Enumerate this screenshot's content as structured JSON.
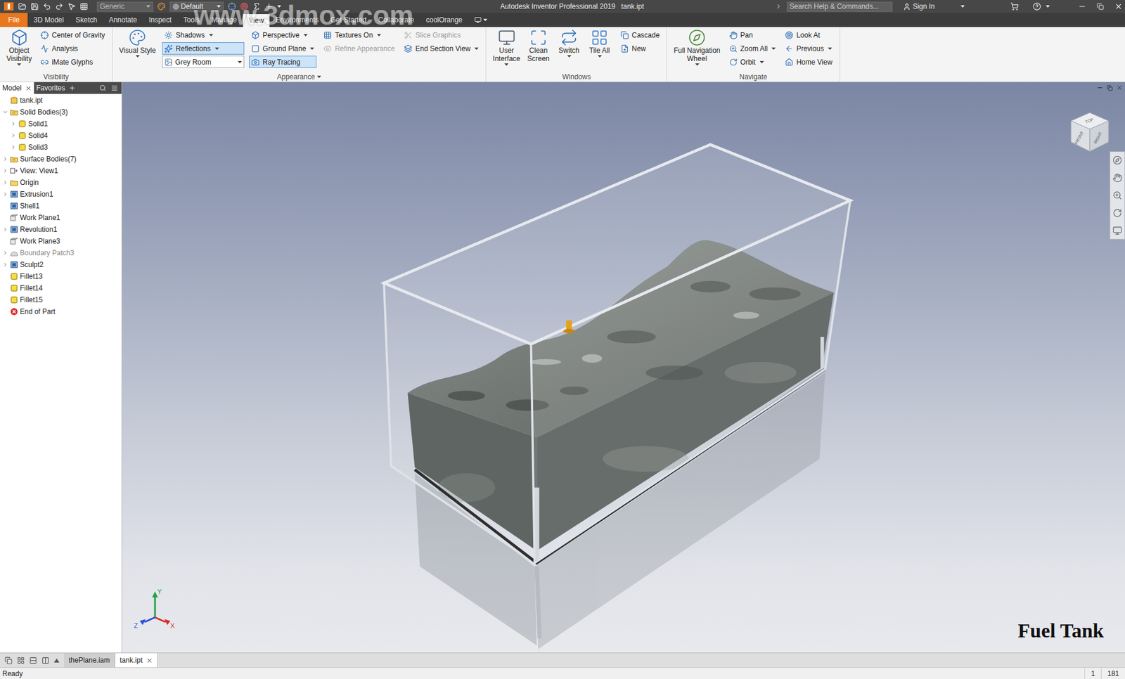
{
  "window": {
    "title": "Autodesk Inventor Professional 2019",
    "document": "tank.ipt"
  },
  "quick_access": {
    "material": "Generic",
    "appearance": "Default"
  },
  "search": {
    "placeholder": "Search Help & Commands..."
  },
  "account": {
    "label": "Sign In"
  },
  "ribbon_tabs": [
    {
      "label": "File",
      "selected": false,
      "kind": "file"
    },
    {
      "label": "3D Model",
      "selected": false,
      "kind": "tab"
    },
    {
      "label": "Sketch",
      "selected": false,
      "kind": "tab"
    },
    {
      "label": "Annotate",
      "selected": false,
      "kind": "tab"
    },
    {
      "label": "Inspect",
      "selected": false,
      "kind": "tab"
    },
    {
      "label": "Tools",
      "selected": false,
      "kind": "tab"
    },
    {
      "label": "Manage",
      "selected": false,
      "kind": "tab"
    },
    {
      "label": "View",
      "selected": true,
      "kind": "tab"
    },
    {
      "label": "Environments",
      "selected": false,
      "kind": "tab"
    },
    {
      "label": "Get Started",
      "selected": false,
      "kind": "tab"
    },
    {
      "label": "Collaborate",
      "selected": false,
      "kind": "tab"
    },
    {
      "label": "coolOrange",
      "selected": false,
      "kind": "tab"
    }
  ],
  "ribbon_panels": [
    {
      "title": "Visibility",
      "dropdown": false,
      "columns": [
        {
          "kind": "large",
          "buttons": [
            {
              "lines": [
                "Object",
                "Visibility"
              ],
              "dropdown": true
            }
          ]
        },
        {
          "kind": "stack",
          "buttons": [
            {
              "label": "Center of Gravity",
              "kind": "button",
              "dropdown": false,
              "active": false,
              "disabled": false
            },
            {
              "label": "Analysis",
              "kind": "button",
              "dropdown": false,
              "active": false,
              "disabled": false
            },
            {
              "label": "iMate Glyphs",
              "kind": "button",
              "dropdown": false,
              "active": false,
              "disabled": false
            }
          ]
        }
      ]
    },
    {
      "title": "Appearance",
      "dropdown": true,
      "columns": [
        {
          "kind": "large",
          "buttons": [
            {
              "lines": [
                "Visual Style"
              ],
              "dropdown": true
            }
          ]
        },
        {
          "kind": "stack",
          "buttons": [
            {
              "label": "Shadows",
              "kind": "button",
              "dropdown": true,
              "active": false,
              "disabled": false
            },
            {
              "label": "Reflections",
              "kind": "button",
              "dropdown": true,
              "active": true,
              "disabled": false
            },
            {
              "label": "Grey Room",
              "kind": "select",
              "dropdown": true,
              "active": false,
              "disabled": false
            }
          ]
        },
        {
          "kind": "stack",
          "buttons": [
            {
              "label": "Perspective",
              "kind": "button",
              "dropdown": true,
              "active": false,
              "disabled": false
            },
            {
              "label": "Ground Plane",
              "kind": "button",
              "dropdown": true,
              "active": false,
              "disabled": false
            },
            {
              "label": "Ray Tracing",
              "kind": "button",
              "dropdown": false,
              "active": true,
              "disabled": false
            }
          ]
        },
        {
          "kind": "stack",
          "buttons": [
            {
              "label": "Textures On",
              "kind": "button",
              "dropdown": true,
              "active": false,
              "disabled": false
            },
            {
              "label": "Refine Appearance",
              "kind": "button",
              "dropdown": false,
              "active": false,
              "disabled": true
            }
          ]
        },
        {
          "kind": "stack",
          "buttons": [
            {
              "label": "Slice Graphics",
              "kind": "button",
              "dropdown": false,
              "active": false,
              "disabled": true
            },
            {
              "label": "End Section View",
              "kind": "button",
              "dropdown": true,
              "active": false,
              "disabled": false
            }
          ]
        }
      ]
    },
    {
      "title": "Windows",
      "dropdown": false,
      "columns": [
        {
          "kind": "large",
          "buttons": [
            {
              "lines": [
                "User",
                "Interface"
              ],
              "dropdown": true
            },
            {
              "lines": [
                "Clean",
                "Screen"
              ],
              "dropdown": false
            },
            {
              "lines": [
                "Switch"
              ],
              "dropdown": true
            },
            {
              "lines": [
                "Tile All"
              ],
              "dropdown": true
            }
          ]
        },
        {
          "kind": "stack",
          "buttons": [
            {
              "label": "Cascade",
              "kind": "button",
              "dropdown": false,
              "active": false,
              "disabled": false
            },
            {
              "label": "New",
              "kind": "button",
              "dropdown": false,
              "active": false,
              "disabled": false
            }
          ]
        }
      ]
    },
    {
      "title": "Navigate",
      "dropdown": false,
      "columns": [
        {
          "kind": "large",
          "buttons": [
            {
              "lines": [
                "Full Navigation",
                "Wheel"
              ],
              "dropdown": true
            }
          ]
        },
        {
          "kind": "stack",
          "buttons": [
            {
              "label": "Pan",
              "kind": "button",
              "dropdown": false,
              "active": false,
              "disabled": false
            },
            {
              "label": "Zoom All",
              "kind": "button",
              "dropdown": true,
              "active": false,
              "disabled": false
            },
            {
              "label": "Orbit",
              "kind": "button",
              "dropdown": true,
              "active": false,
              "disabled": false
            }
          ]
        },
        {
          "kind": "stack",
          "buttons": [
            {
              "label": "Look At",
              "kind": "button",
              "dropdown": false,
              "active": false,
              "disabled": false
            },
            {
              "label": "Previous",
              "kind": "button",
              "dropdown": true,
              "active": false,
              "disabled": false
            },
            {
              "label": "Home View",
              "kind": "button",
              "dropdown": false,
              "active": false,
              "disabled": false
            }
          ]
        }
      ]
    }
  ],
  "browser": {
    "tabs": [
      {
        "label": "Model",
        "selected": true
      },
      {
        "label": "Favorites",
        "selected": false
      }
    ],
    "tree": [
      {
        "label": "tank.ipt",
        "level": 0,
        "expander": "none",
        "greyed": false,
        "kind": "part"
      },
      {
        "label": "Solid Bodies(3)",
        "level": 0,
        "expander": "expanded",
        "greyed": false,
        "kind": "folder"
      },
      {
        "label": "Solid1",
        "level": 1,
        "expander": "collapsed",
        "greyed": false,
        "kind": "body"
      },
      {
        "label": "Solid4",
        "level": 1,
        "expander": "collapsed",
        "greyed": false,
        "kind": "body"
      },
      {
        "label": "Solid3",
        "level": 1,
        "expander": "collapsed",
        "greyed": false,
        "kind": "body"
      },
      {
        "label": "Surface Bodies(7)",
        "level": 0,
        "expander": "collapsed",
        "greyed": false,
        "kind": "folder"
      },
      {
        "label": "View: View1",
        "level": 0,
        "expander": "collapsed",
        "greyed": false,
        "kind": "view"
      },
      {
        "label": "Origin",
        "level": 0,
        "expander": "collapsed",
        "greyed": false,
        "kind": "origin"
      },
      {
        "label": "Extrusion1",
        "level": 0,
        "expander": "collapsed",
        "greyed": false,
        "kind": "feature"
      },
      {
        "label": "Shell1",
        "level": 0,
        "expander": "none",
        "greyed": false,
        "kind": "feature"
      },
      {
        "label": "Work Plane1",
        "level": 0,
        "expander": "none",
        "greyed": false,
        "kind": "plane"
      },
      {
        "label": "Revolution1",
        "level": 0,
        "expander": "collapsed",
        "greyed": false,
        "kind": "feature"
      },
      {
        "label": "Work Plane3",
        "level": 0,
        "expander": "none",
        "greyed": false,
        "kind": "plane"
      },
      {
        "label": "Boundary Patch3",
        "level": 0,
        "expander": "collapsed",
        "greyed": true,
        "kind": "surface"
      },
      {
        "label": "Sculpt2",
        "level": 0,
        "expander": "collapsed",
        "greyed": false,
        "kind": "feature"
      },
      {
        "label": "Fillet13",
        "level": 0,
        "expander": "none",
        "greyed": false,
        "kind": "fillet"
      },
      {
        "label": "Fillet14",
        "level": 0,
        "expander": "none",
        "greyed": false,
        "kind": "fillet"
      },
      {
        "label": "Fillet15",
        "level": 0,
        "expander": "none",
        "greyed": false,
        "kind": "fillet"
      },
      {
        "label": "End of Part",
        "level": 0,
        "expander": "none",
        "greyed": false,
        "kind": "end"
      }
    ]
  },
  "viewport": {
    "view_cube": {
      "faces": [
        "TOP",
        "FRONT",
        "RIGHT"
      ]
    },
    "axes": [
      {
        "label": "Y",
        "color": "#22a046"
      },
      {
        "label": "X",
        "color": "#d42a2a"
      },
      {
        "label": "Z",
        "color": "#2a4fd4"
      }
    ],
    "caption": "Fuel Tank",
    "watermark": "www.3dmox.com"
  },
  "document_tabs": [
    {
      "label": "thePlane.iam",
      "selected": false
    },
    {
      "label": "tank.ipt",
      "selected": true
    }
  ],
  "status_bar": {
    "message": "Ready",
    "fields": [
      "1",
      "181"
    ]
  }
}
